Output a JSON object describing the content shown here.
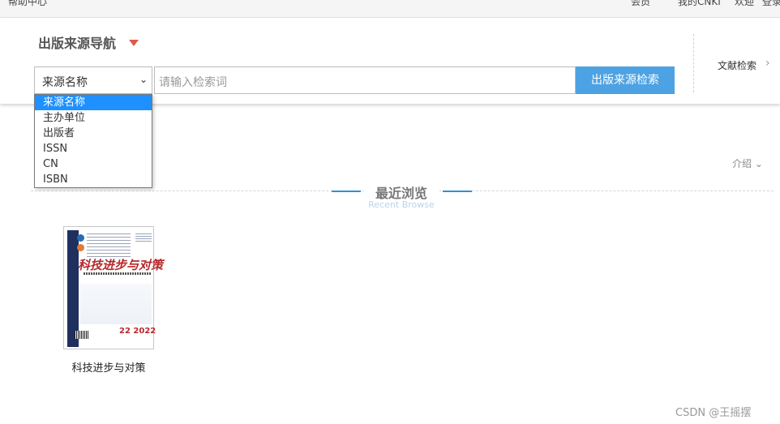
{
  "topbar": {
    "help_center": "帮助中心",
    "member": "会员",
    "my_cnki": "我的CNKI",
    "welcome": "欢迎",
    "login": "登录"
  },
  "nav": {
    "title": "出版来源导航"
  },
  "search": {
    "field_selected": "来源名称",
    "input_placeholder": "请输入检索词",
    "button_label": "出版来源检索",
    "field_options": [
      "来源名称",
      "主办单位",
      "出版者",
      "ISSN",
      "CN",
      "ISBN"
    ]
  },
  "side": {
    "doc_search": "文献检索"
  },
  "intro": {
    "label": "介绍"
  },
  "recent": {
    "title": "最近浏览",
    "subtitle": "Recent Browse",
    "items": [
      {
        "name": "科技进步与对策",
        "cover_title": "科技进步与对策",
        "issue": "22 2022"
      }
    ]
  },
  "watermark": "CSDN @王摇摆",
  "colors": {
    "accent_blue": "#4da2e3",
    "selected_blue": "#1e90ff",
    "caret_red": "#e05a4b",
    "cover_red": "#b5282b"
  }
}
